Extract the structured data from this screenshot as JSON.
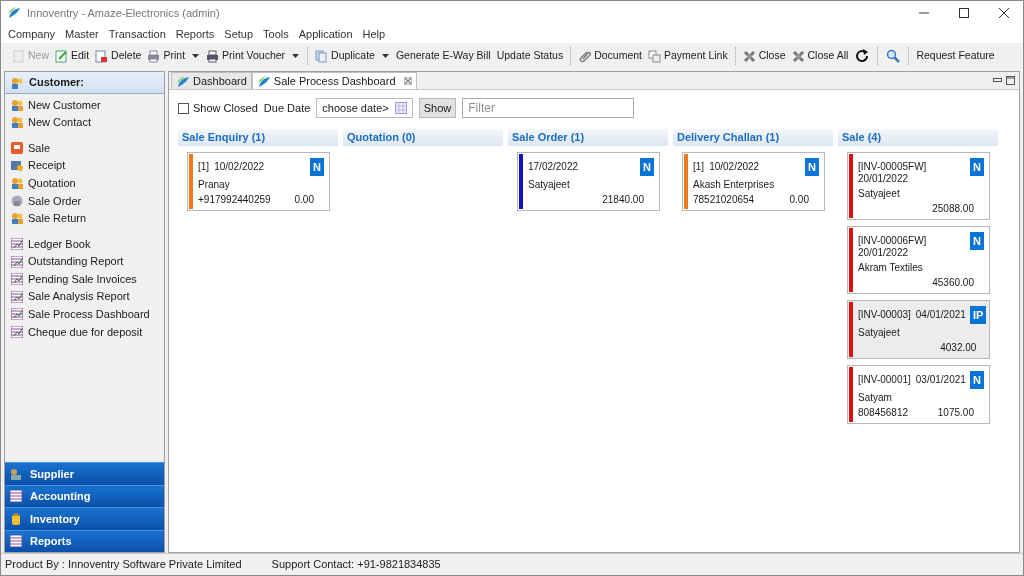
{
  "window": {
    "title": "Innoventry - Amaze-Electronics (admin)"
  },
  "menu": [
    "Company",
    "Master",
    "Transaction",
    "Reports",
    "Setup",
    "Tools",
    "Application",
    "Help"
  ],
  "toolbar": [
    [
      {
        "kind": "button",
        "label": "New",
        "disabled": true
      },
      {
        "kind": "button",
        "label": "Edit",
        "disabled": false
      },
      {
        "kind": "button",
        "label": "Delete",
        "disabled": false
      },
      {
        "kind": "button",
        "label": "Print",
        "disabled": false
      },
      {
        "kind": "caret"
      },
      {
        "kind": "button",
        "label": "Print Voucher",
        "disabled": false
      },
      {
        "kind": "caret"
      }
    ],
    [
      {
        "kind": "button",
        "label": "Duplicate",
        "disabled": false
      },
      {
        "kind": "caret"
      },
      {
        "kind": "button",
        "label": "Generate E-Way Bill",
        "disabled": false
      },
      {
        "kind": "button",
        "label": "Update Status",
        "disabled": false
      }
    ],
    [
      {
        "kind": "button",
        "label": "Document",
        "disabled": false
      },
      {
        "kind": "button",
        "label": "Payment Link",
        "disabled": false
      }
    ],
    [
      {
        "kind": "button",
        "label": "Close",
        "disabled": false
      },
      {
        "kind": "button",
        "label": "Close All",
        "disabled": false
      },
      {
        "kind": "icon-button"
      }
    ],
    [
      {
        "kind": "icon-button"
      }
    ],
    [
      {
        "kind": "button",
        "label": "Request Feature",
        "disabled": false
      }
    ]
  ],
  "sidebar": {
    "header": "Customer:",
    "groups": [
      [
        "New Customer",
        "New Contact"
      ],
      [
        "Sale",
        "Receipt",
        "Quotation",
        "Sale Order",
        "Sale Return"
      ],
      [
        "Ledger Book",
        "Outstanding Report",
        "Pending Sale Invoices",
        "Sale Analysis Report",
        "Sale Process Dashboard",
        "Cheque due for deposit"
      ]
    ],
    "sections": [
      "Supplier",
      "Accounting",
      "Inventory",
      "Reports"
    ]
  },
  "tabs": [
    {
      "label": "Dashboard",
      "selected": false,
      "closable": false
    },
    {
      "label": "Sale Process Dashboard",
      "selected": true,
      "closable": true
    }
  ],
  "filters": {
    "show_closed": {
      "label": "Show Closed",
      "checked": false
    },
    "due_date_label": "Due Date",
    "date_field": "choose date>",
    "show_button": "Show",
    "filter": {
      "placeholder": "Filter"
    }
  },
  "columns": [
    {
      "title": "Sale Enquiry (1)",
      "cards": [
        {
          "ref": "[1]",
          "date": "10/02/2022",
          "badge": "N",
          "name": "Pranay",
          "phone": "+917992440259",
          "amount": "0.00",
          "color": "#f07a1a",
          "selected": false
        }
      ]
    },
    {
      "title": "Quotation (0)"
    },
    {
      "title": "Sale Order (1)",
      "cards": [
        {
          "date": "17/02/2022",
          "badge": "N",
          "name": "Satyajeet",
          "amount": "21840.00",
          "color": "#1010c0",
          "selected": false
        }
      ]
    },
    {
      "title": "Delivery Challan (1)",
      "cards": [
        {
          "ref": "[1]",
          "date": "10/02/2022",
          "badge": "N",
          "name": "Akash Enterprises",
          "phone": "78521020654",
          "amount": "0.00",
          "color": "#f07a1a",
          "selected": false
        }
      ]
    },
    {
      "title": "Sale (4)",
      "cards": [
        {
          "ref": "[INV-00005FW]",
          "date": "20/01/2022",
          "badge": "N",
          "name": "Satyajeet",
          "amount": "25088.00",
          "color": "#e01010",
          "selected": false
        },
        {
          "ref": "[INV-00006FW]",
          "date": "20/01/2022",
          "badge": "N",
          "name": "Akram Textiles",
          "amount": "45360.00",
          "color": "#e01010",
          "selected": false
        },
        {
          "ref": "[INV-00003]",
          "date": "04/01/2021",
          "badge": "IP",
          "name": "Satyajeet",
          "amount": "4032.00",
          "color": "#e01010",
          "selected": true
        },
        {
          "ref": "[INV-00001]",
          "date": "03/01/2021",
          "badge": "N",
          "name": "Satyam",
          "phone": "808456812",
          "amount": "1075.00",
          "color": "#e01010",
          "selected": false
        }
      ]
    }
  ],
  "status_bar": [
    "Product By : Innoventry Software Private Limited",
    "Support Contact: +91-9821834835"
  ]
}
